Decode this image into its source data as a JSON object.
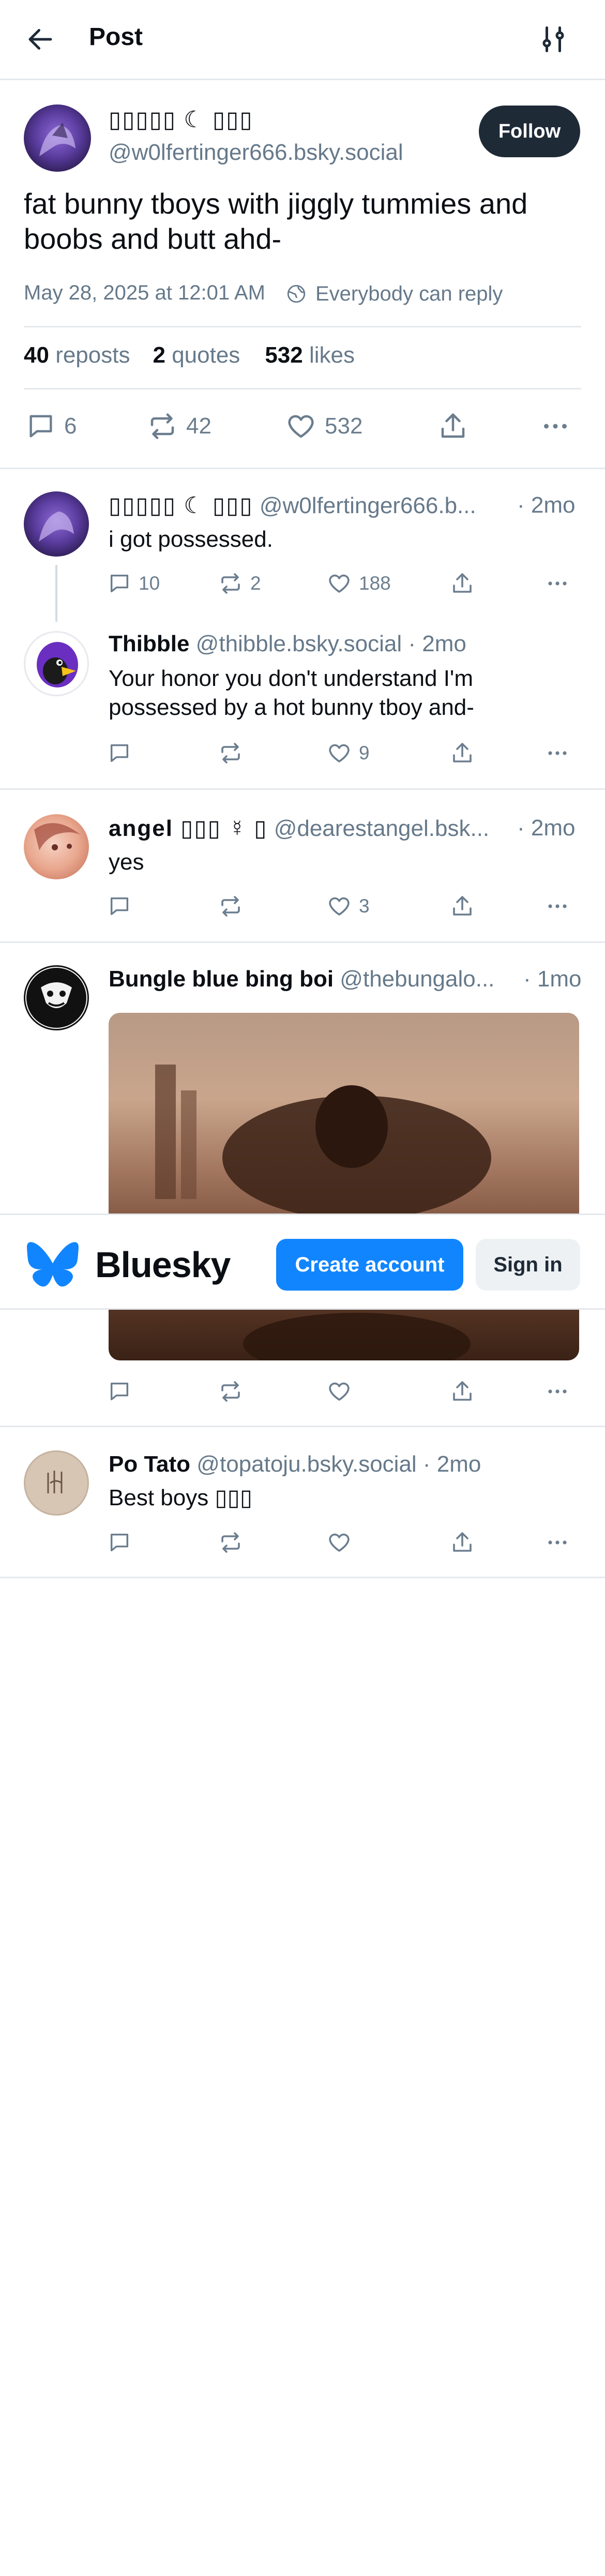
{
  "header": {
    "back_icon": "arrow-left-icon",
    "title": "Post",
    "settings_icon": "sliders-icon"
  },
  "main_post": {
    "display_name": "▯▯▯▯▯ ☾ ▯▯▯",
    "handle": "@w0lfertinger666.bsky.social",
    "follow_label": "Follow",
    "text": "fat bunny tboys with jiggly tummies and boobs and butt ahd-",
    "timestamp": "May 28, 2025 at 12:01 AM",
    "reply_setting": "Everybody can reply",
    "stats": {
      "reposts_count": "40",
      "reposts_label": "reposts",
      "quotes_count": "2",
      "quotes_label": "quotes",
      "likes_count": "532",
      "likes_label": "likes"
    },
    "actions": {
      "replies": "6",
      "reposts": "42",
      "likes": "532"
    }
  },
  "replies": [
    {
      "display_name": "▯▯▯▯▯ ☾ ▯▯▯",
      "handle": "@w0lfertinger666.b...",
      "age": "· 2mo",
      "text": "i got possessed.",
      "replies": "10",
      "reposts": "2",
      "likes": "188"
    },
    {
      "display_name": "Thibble",
      "handle": "@thibble.bsky.social · 2mo",
      "text_line1": "Your honor you don't understand I'm",
      "text_line2": "possessed by a hot bunny tboy and-",
      "likes": "9"
    },
    {
      "display_name": "angel ▯▯▯ ☿ ▯",
      "handle": "@dearestangel.bsk...",
      "age": "· 2mo",
      "text": "yes",
      "likes": "3"
    },
    {
      "display_name": "Bungle blue bing boi",
      "handle": "@thebungalo...",
      "age": "· 1mo"
    },
    {
      "display_name": "Po Tato",
      "handle": "@topatoju.bsky.social · 2mo",
      "text": "Best boys ▯▯▯"
    }
  ],
  "banner": {
    "brand": "Bluesky",
    "create_account": "Create account",
    "sign_in": "Sign in",
    "colors": {
      "brand_blue": "#1185fe",
      "dark_button": "#1f2a37"
    }
  }
}
